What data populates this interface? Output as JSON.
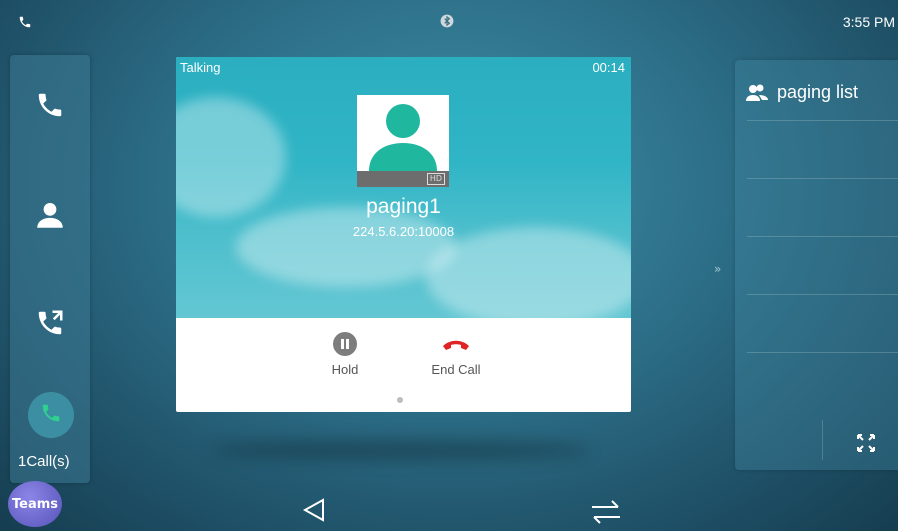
{
  "status_bar": {
    "time": "3:55 PM"
  },
  "sidebar": {
    "items": [
      {
        "icon": "phone-icon"
      },
      {
        "icon": "contact-icon"
      },
      {
        "icon": "call-forward-icon"
      }
    ],
    "active_calls_label": "1Call(s)"
  },
  "teams": {
    "label": "Teams"
  },
  "call": {
    "status": "Talking",
    "timer": "00:14",
    "hd_badge": "HD",
    "contact_name": "paging1",
    "contact_address": "224.5.6.20:10008",
    "actions": {
      "hold_label": "Hold",
      "end_call_label": "End Call"
    }
  },
  "right_panel": {
    "title": "paging list"
  },
  "colors": {
    "end_call": "#e02424",
    "avatar_green": "#1fb79e",
    "accent": "#2aaec0"
  }
}
